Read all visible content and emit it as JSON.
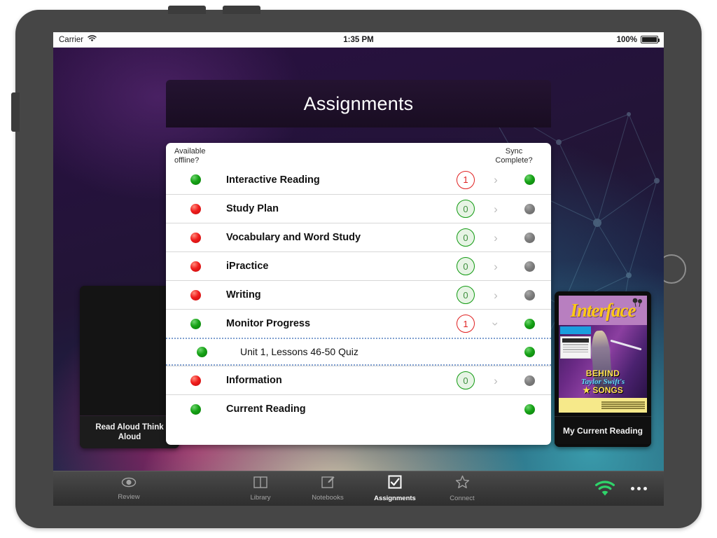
{
  "status_bar": {
    "carrier": "Carrier",
    "wifi_icon": "wifi-icon",
    "time": "1:35 PM",
    "battery_percent": "100%",
    "battery_icon": "battery-full-icon"
  },
  "header": {
    "title": "Assignments"
  },
  "columns": {
    "available_offline": "Available\noffline?",
    "available_offline_line1": "Available",
    "available_offline_line2": "offline?",
    "sync_complete_line1": "Sync",
    "sync_complete_line2": "Complete?"
  },
  "rows": [
    {
      "offline": "green",
      "label": "Interactive Reading",
      "badge": "1",
      "badge_style": "red",
      "chevron": "right",
      "sync": "green"
    },
    {
      "offline": "red",
      "label": "Study Plan",
      "badge": "0",
      "badge_style": "green",
      "chevron": "right",
      "sync": "gray"
    },
    {
      "offline": "red",
      "label": "Vocabulary and Word Study",
      "badge": "0",
      "badge_style": "green",
      "chevron": "right",
      "sync": "gray"
    },
    {
      "offline": "red",
      "label": "iPractice",
      "badge": "0",
      "badge_style": "green",
      "chevron": "right",
      "sync": "gray"
    },
    {
      "offline": "red",
      "label": "Writing",
      "badge": "0",
      "badge_style": "green",
      "chevron": "right",
      "sync": "gray"
    },
    {
      "offline": "green",
      "label": "Monitor Progress",
      "badge": "1",
      "badge_style": "red",
      "chevron": "down",
      "sync": "green"
    },
    {
      "offline": "green",
      "label": "Unit 1, Lessons 46-50 Quiz",
      "badge": "",
      "badge_style": "",
      "chevron": "",
      "sync": "green",
      "sub": true
    },
    {
      "offline": "red",
      "label": "Information",
      "badge": "0",
      "badge_style": "green",
      "chevron": "right",
      "sync": "gray"
    },
    {
      "offline": "green",
      "label": "Current Reading",
      "badge": "",
      "badge_style": "",
      "chevron": "",
      "sync": "green"
    }
  ],
  "left_panel": {
    "caption_line1": "Read Aloud Think",
    "caption_line2": "Aloud"
  },
  "right_panel": {
    "magazine_title": "Interface",
    "headline_line1": "BEHIND",
    "headline_line2": "Taylor Swift's",
    "headline_line3": "★ SONGS",
    "caption": "My Current Reading"
  },
  "tabbar": {
    "tabs": [
      {
        "label": "Review",
        "icon": "eye-icon",
        "active": false
      },
      {
        "label": "Library",
        "icon": "book-icon",
        "active": false
      },
      {
        "label": "Notebooks",
        "icon": "notebook-icon",
        "active": false
      },
      {
        "label": "Assignments",
        "icon": "checkbox-icon",
        "active": true
      },
      {
        "label": "Connect",
        "icon": "star-icon",
        "active": false
      }
    ],
    "wifi_icon": "wifi-signal-icon",
    "more_icon": "more-dots-icon"
  },
  "colors": {
    "accent_green": "#16a216",
    "accent_red": "#f01d1d",
    "badge_red": "#e02020",
    "badge_green": "#119a11",
    "wifi_green": "#2fd46a",
    "header_bg": "#241331"
  }
}
